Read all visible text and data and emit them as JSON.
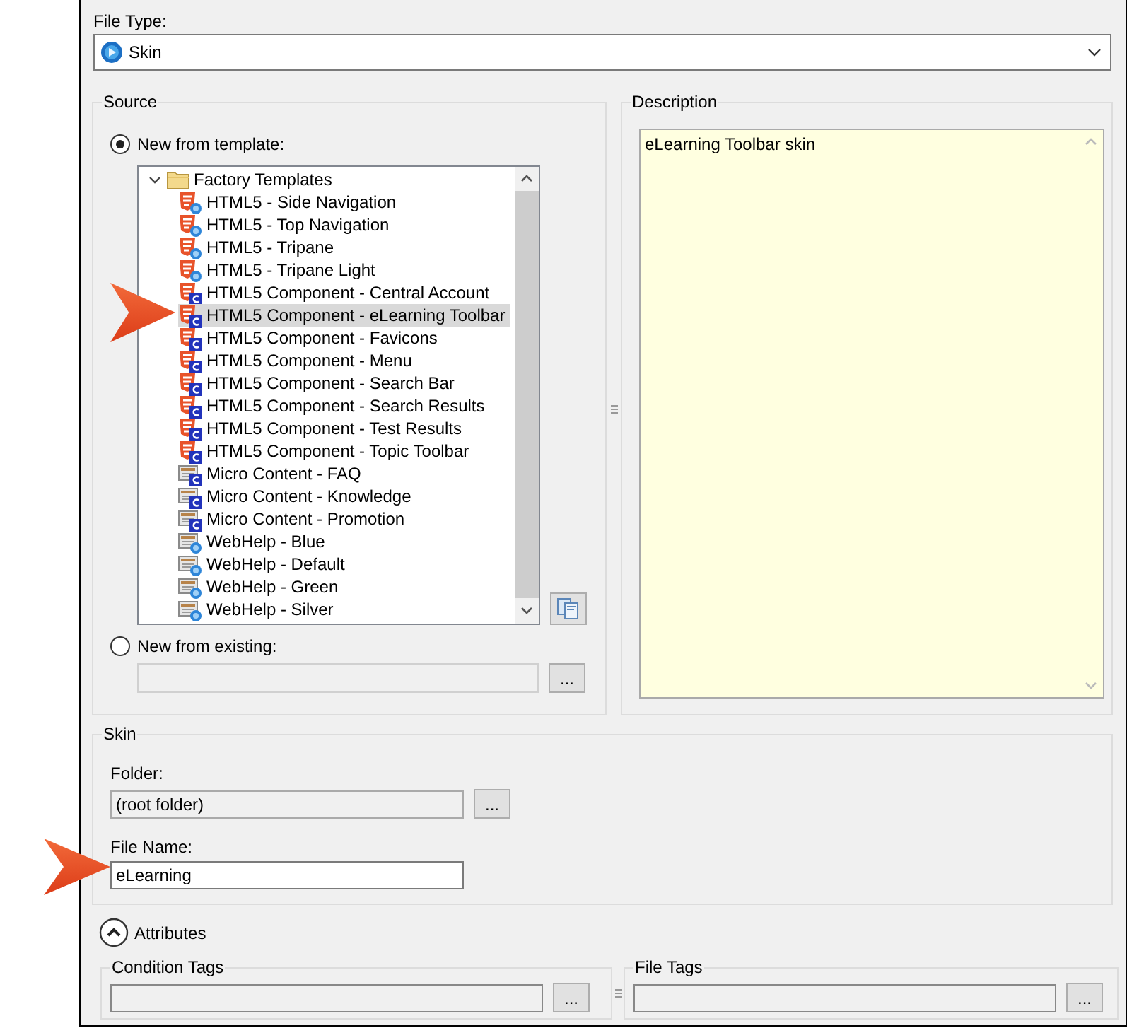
{
  "file_type": {
    "label": "File Type:",
    "value": "Skin"
  },
  "source": {
    "title": "Source",
    "options": [
      {
        "label": "New from template:",
        "selected": true
      },
      {
        "label": "New from existing:",
        "selected": false
      }
    ],
    "tree": {
      "label": "Factory Templates",
      "expanded": true,
      "children": [
        {
          "label": "HTML5 - Side Navigation",
          "kind": "html5",
          "selected": false
        },
        {
          "label": "HTML5 - Top Navigation",
          "kind": "html5",
          "selected": false
        },
        {
          "label": "HTML5 - Tripane",
          "kind": "html5",
          "selected": false
        },
        {
          "label": "HTML5 - Tripane Light",
          "kind": "html5",
          "selected": false
        },
        {
          "label": "HTML5 Component - Central Account",
          "kind": "component",
          "selected": false
        },
        {
          "label": "HTML5 Component - eLearning Toolbar",
          "kind": "component",
          "selected": true
        },
        {
          "label": "HTML5 Component - Favicons",
          "kind": "component",
          "selected": false
        },
        {
          "label": "HTML5 Component - Menu",
          "kind": "component",
          "selected": false
        },
        {
          "label": "HTML5 Component - Search Bar",
          "kind": "component",
          "selected": false
        },
        {
          "label": "HTML5 Component - Search Results",
          "kind": "component",
          "selected": false
        },
        {
          "label": "HTML5 Component - Test Results",
          "kind": "component",
          "selected": false
        },
        {
          "label": "HTML5 Component - Topic Toolbar",
          "kind": "component",
          "selected": false
        },
        {
          "label": "Micro Content - FAQ",
          "kind": "micro",
          "selected": false
        },
        {
          "label": "Micro Content - Knowledge",
          "kind": "micro",
          "selected": false
        },
        {
          "label": "Micro Content - Promotion",
          "kind": "micro",
          "selected": false
        },
        {
          "label": "WebHelp - Blue",
          "kind": "webhelp",
          "selected": false
        },
        {
          "label": "WebHelp - Default",
          "kind": "webhelp",
          "selected": false
        },
        {
          "label": "WebHelp - Green",
          "kind": "webhelp",
          "selected": false
        },
        {
          "label": "WebHelp - Silver",
          "kind": "webhelp",
          "selected": false
        }
      ]
    },
    "existing_button": "..."
  },
  "description": {
    "title": "Description",
    "text": "eLearning Toolbar skin"
  },
  "skin": {
    "title": "Skin",
    "folder_label": "Folder:",
    "folder_value": "(root folder)",
    "folder_button": "...",
    "file_name_label": "File Name:",
    "file_name_value": "eLearning"
  },
  "attributes": {
    "label": "Attributes",
    "expanded": true,
    "condition_tags": {
      "title": "Condition Tags",
      "button": "..."
    },
    "file_tags": {
      "title": "File Tags",
      "button": "..."
    }
  }
}
